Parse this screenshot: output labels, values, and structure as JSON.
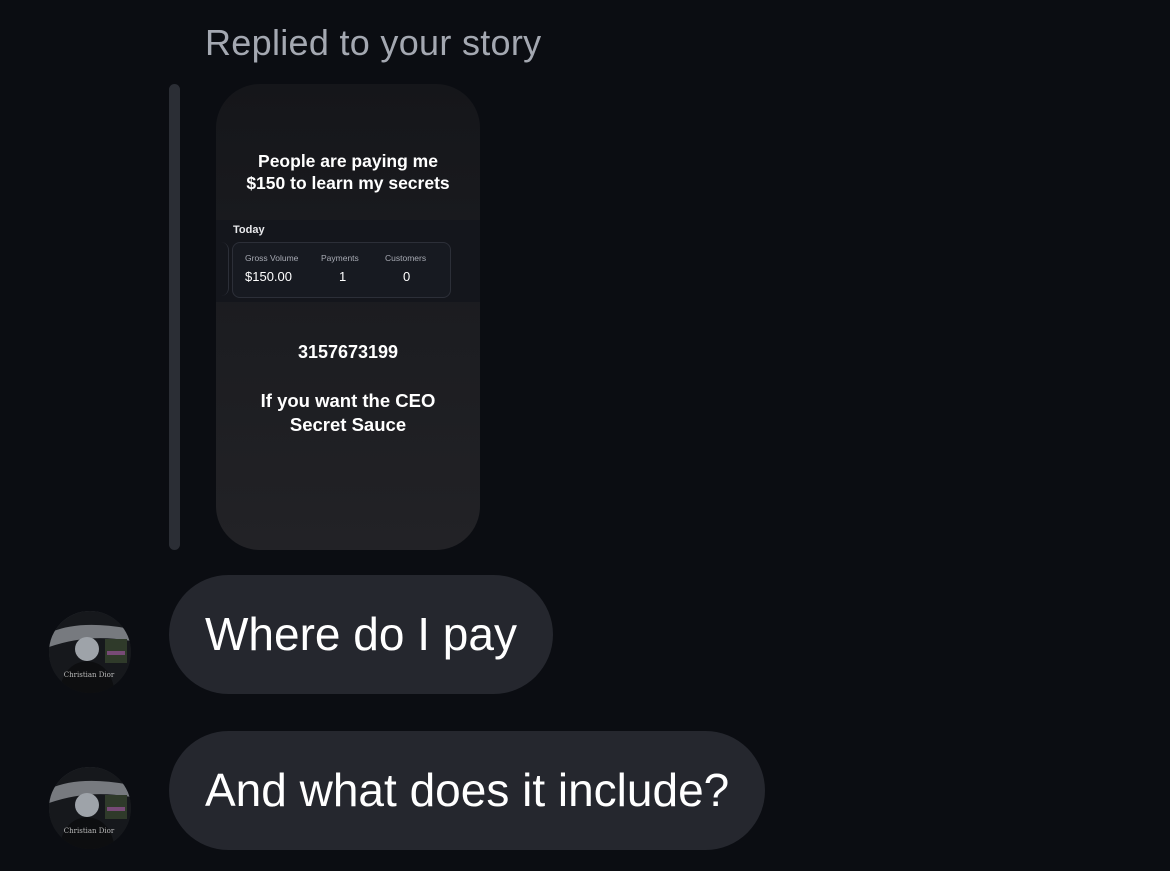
{
  "thread": {
    "replied_label": "Replied to your story"
  },
  "story": {
    "headline_line1": "People are paying me",
    "headline_line2": "$150 to learn my secrets",
    "stats": {
      "period_label": "Today",
      "columns": [
        {
          "label": "Gross Volume",
          "value": "$150.00"
        },
        {
          "label": "Payments",
          "value": "1"
        },
        {
          "label": "Customers",
          "value": "0"
        }
      ]
    },
    "phone": "3157673199",
    "cta_line1": "If you want the CEO",
    "cta_line2": "Secret Sauce"
  },
  "messages": [
    {
      "text": "Where do I pay",
      "avatar_icon": "user-avatar"
    },
    {
      "text": "And what does it include?",
      "avatar_icon": "user-avatar"
    }
  ],
  "colors": {
    "background": "#0b0d12",
    "bubble": "#25272e",
    "muted_text": "#a4a8b1"
  }
}
